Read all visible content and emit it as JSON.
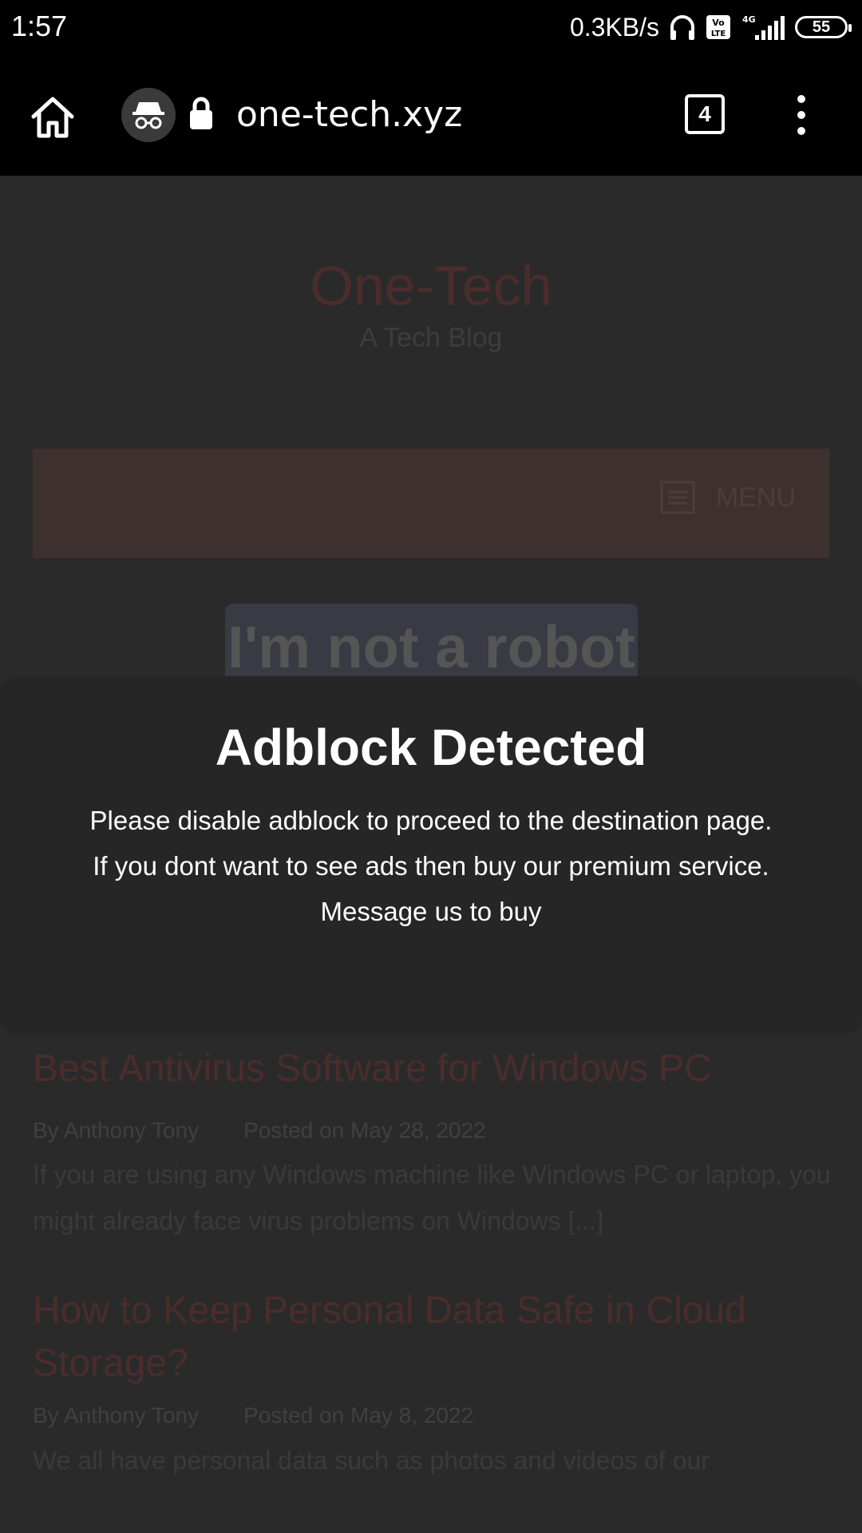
{
  "status_bar": {
    "time": "1:57",
    "net_speed": "0.3KB/s",
    "battery": "55"
  },
  "browser": {
    "url": "one-tech.xyz",
    "tab_count": "4"
  },
  "site": {
    "title": "One-Tech",
    "tagline": "A Tech Blog",
    "menu_label": "MENU",
    "robot_text": "I'm not a robot"
  },
  "posts": [
    {
      "title": "Best Antivirus Software for Windows PC",
      "author": "By Anthony Tony",
      "date": "Posted on May 28, 2022",
      "excerpt": "If you are using any Windows machine like Windows PC or laptop, you might already face virus problems on Windows [...]"
    },
    {
      "title": "How to Keep Personal Data Safe in Cloud Storage?",
      "author": "By Anthony Tony",
      "date": "Posted on May 8, 2022",
      "excerpt": "We all have personal data such as photos and videos of our"
    }
  ],
  "modal": {
    "title": "Adblock Detected",
    "line1": "Please disable adblock to proceed to the destination page.",
    "line2": "If you dont want to see ads then buy our premium service.",
    "line3": "Message us to buy"
  }
}
